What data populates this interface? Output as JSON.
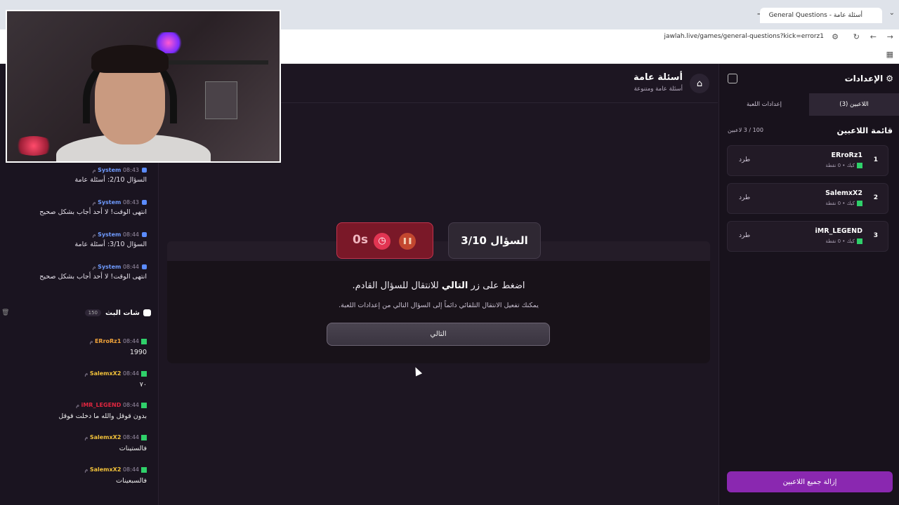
{
  "browser": {
    "tab_title": "General Questions - أسئلة عامة",
    "url": "jawlah.live/games/general-questions?kick=errorz1"
  },
  "left": {
    "system_messages": [
      {
        "sender": "System",
        "time": "08:43 م",
        "text": "السؤال 2/10: أسئلة عامة"
      },
      {
        "sender": "System",
        "time": "08:43 م",
        "text": "انتهى الوقت! لا أحد أجاب بشكل صحيح"
      },
      {
        "sender": "System",
        "time": "08:44 م",
        "text": "السؤال 3/10: أسئلة عامة"
      },
      {
        "sender": "System",
        "time": "08:44 م",
        "text": "انتهى الوقت! لا أحد أجاب بشكل صحيح"
      }
    ],
    "stream_chat_title": "شات البث",
    "viewer_count": "150",
    "chat_messages": [
      {
        "user": "ERroRz1",
        "time": "08:44 م",
        "text": "1990",
        "color": "#f2a43a"
      },
      {
        "user": "SalemxX2",
        "time": "08:44 م",
        "text": "٧٠",
        "color": "#f2c23a"
      },
      {
        "user": "iMR_LEGEND",
        "time": "08:44 م",
        "text": "بدون قوقل والله ما دخلت قوقل",
        "color": "#e0263f"
      },
      {
        "user": "SalemxX2",
        "time": "08:44 م",
        "text": "فالستينات",
        "color": "#f2c23a"
      },
      {
        "user": "SalemxX2",
        "time": "08:44 م",
        "text": "فالسبعينات",
        "color": "#f2c23a"
      }
    ]
  },
  "main": {
    "title": "أسئلة عامة",
    "subtitle": "أسئلة عامة ومتنوعة",
    "timer": "0s",
    "question_label": "السؤال 3/10",
    "prompt_before": "اضغط على زر ",
    "prompt_bold": "التالي",
    "prompt_after": " للانتقال للسؤال القادم.",
    "auto_hint": "يمكنك تفعيل الانتقال التلقائي دائماً إلى السؤال التالي من إعدادات اللعبة.",
    "next_label": "التالي"
  },
  "right": {
    "settings_title": "الإعدادات",
    "tabs": [
      "اللاعبين (3)",
      "إعدادات اللعبة"
    ],
    "players_title": "قائمة اللاعبين",
    "players_count": "100 / 3 لاعبين",
    "players": [
      {
        "rank": "1",
        "name": "ERroRz1",
        "meta": "كيك • 0 نقطة",
        "kick": "طرد"
      },
      {
        "rank": "2",
        "name": "SalemxX2",
        "meta": "كيك • 0 نقطة",
        "kick": "طرد"
      },
      {
        "rank": "3",
        "name": "iMR_LEGEND",
        "meta": "كيك • 0 نقطة",
        "kick": "طرد"
      }
    ],
    "remove_all": "إزالة جميع اللاعبين"
  },
  "colors": {
    "accent": "#8a28b0",
    "kick_green": "#2fd06a",
    "timer_red": "#e23552"
  },
  "icons": [
    "home-icon",
    "gear-icon",
    "collapse-sidebar-icon",
    "clock-icon",
    "pause-icon",
    "chat-icon",
    "trash-icon",
    "kick-logo-icon"
  ]
}
